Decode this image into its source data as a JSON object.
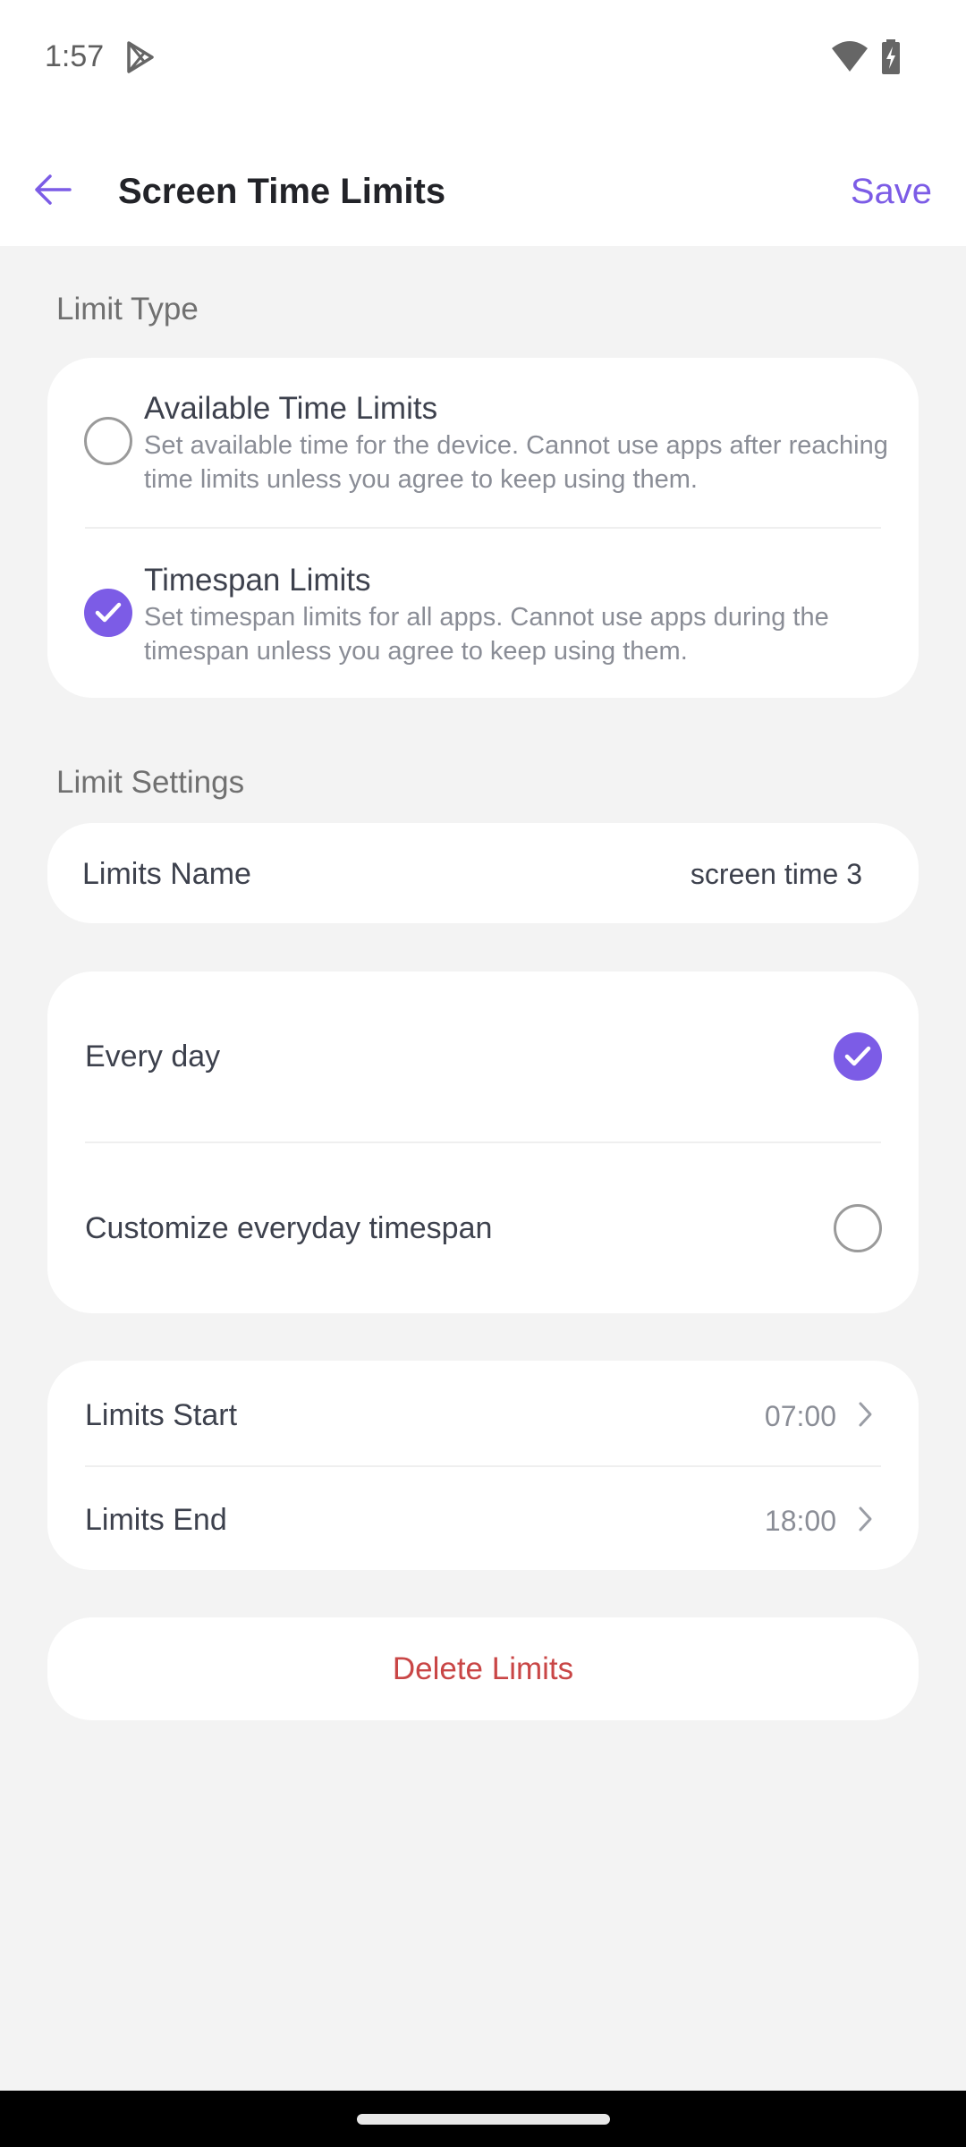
{
  "status_bar": {
    "time": "1:57",
    "icons": [
      "play-store-icon",
      "wifi-icon",
      "battery-charging-icon"
    ]
  },
  "app_bar": {
    "title": "Screen Time Limits",
    "back_icon": "arrow-left-icon",
    "save_label": "Save"
  },
  "limit_type": {
    "section_label": "Limit Type",
    "options": [
      {
        "title": "Available Time Limits",
        "description": "Set available time for the device. Cannot use apps after reaching time limits unless you agree to keep using them.",
        "selected": false
      },
      {
        "title": "Timespan Limits",
        "description": "Set timespan limits for all apps. Cannot use apps during the timespan unless you agree to keep using them.",
        "selected": true
      }
    ]
  },
  "limit_settings": {
    "section_label": "Limit Settings",
    "name_label": "Limits Name",
    "name_value": "screen time 3",
    "schedule_options": [
      {
        "label": "Every day",
        "selected": true
      },
      {
        "label": "Customize everyday timespan",
        "selected": false
      }
    ],
    "times": [
      {
        "label": "Limits Start",
        "value": "07:00"
      },
      {
        "label": "Limits End",
        "value": "18:00"
      }
    ],
    "delete_label": "Delete Limits"
  },
  "colors": {
    "accent": "#7c5ce6",
    "danger": "#c94646",
    "background": "#f3f3f3",
    "card": "#ffffff"
  }
}
